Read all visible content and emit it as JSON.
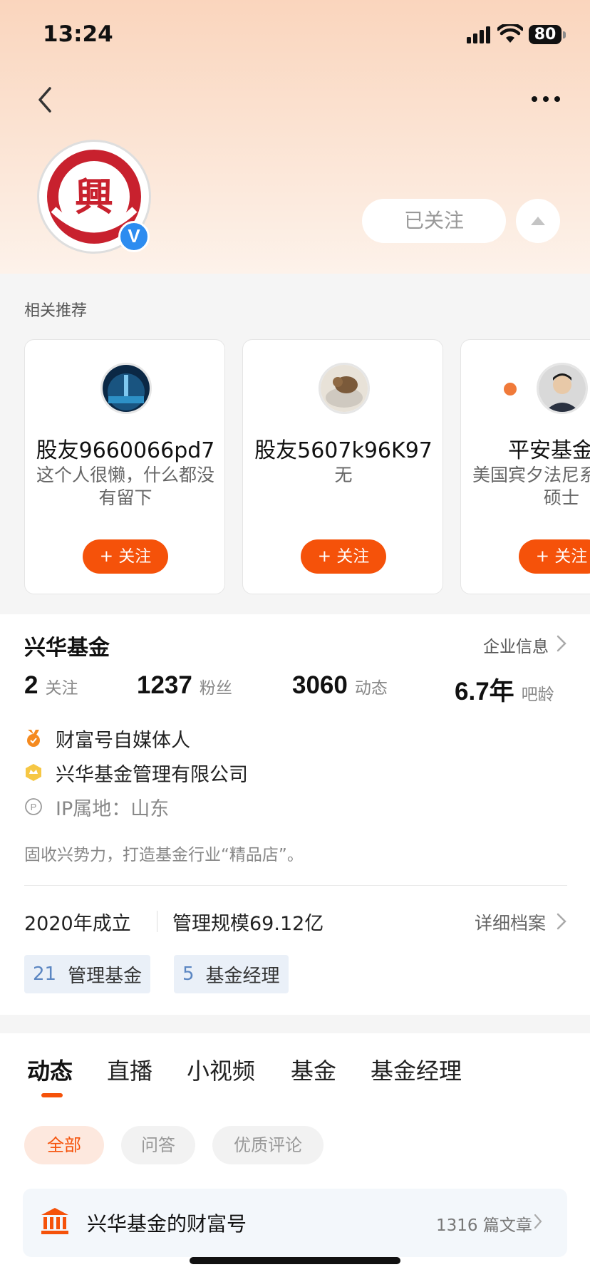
{
  "status_bar": {
    "time": "13:24",
    "battery": "80"
  },
  "profile": {
    "follow_state": "已关注",
    "avatar_seal": "興",
    "verified_mark": "V"
  },
  "recommendations": {
    "title": "相关推荐",
    "cards": [
      {
        "name": "股友9660066pd7",
        "desc": "这个人很懒，什么都没有留下",
        "follow": "+ 关注"
      },
      {
        "name": "股友5607k96K97",
        "desc": "无",
        "follow": "+ 关注"
      },
      {
        "name": "平安基金林",
        "desc": "美国宾夕法尼系统工程硕士",
        "follow": "+ 关注"
      }
    ]
  },
  "info": {
    "name": "兴华基金",
    "company_link": "企业信息",
    "stats": [
      {
        "value": "2",
        "label": "关注"
      },
      {
        "value": "1237",
        "label": "粉丝"
      },
      {
        "value": "3060",
        "label": "动态"
      },
      {
        "value": "6.7年",
        "label": "吧龄"
      }
    ],
    "tags": [
      {
        "text": "财富号自媒体人",
        "icon": "medal-icon"
      },
      {
        "text": "兴华基金管理有限公司",
        "icon": "enterprise-badge-icon"
      },
      {
        "text": "IP属地：山东",
        "icon": "ip-location-icon"
      }
    ],
    "bio": "固收兴势力，打造基金行业“精品店”。",
    "founded": "2020年成立",
    "scale": "管理规模69.12亿",
    "archive_link": "详细档案",
    "chips": [
      {
        "num": "21",
        "label": "管理基金"
      },
      {
        "num": "5",
        "label": "基金经理"
      }
    ]
  },
  "tabs": {
    "items": [
      "动态",
      "直播",
      "小视频",
      "基金",
      "基金经理"
    ],
    "active": "动态",
    "filters": [
      "全部",
      "问答",
      "优质评论"
    ],
    "active_filter": "全部"
  },
  "wealth": {
    "name": "兴华基金的财富号",
    "count": "1316 篇文章"
  },
  "colors": {
    "accent": "#f5520a",
    "verified_blue": "#2d8cf0",
    "seal_red": "#c8212e"
  }
}
